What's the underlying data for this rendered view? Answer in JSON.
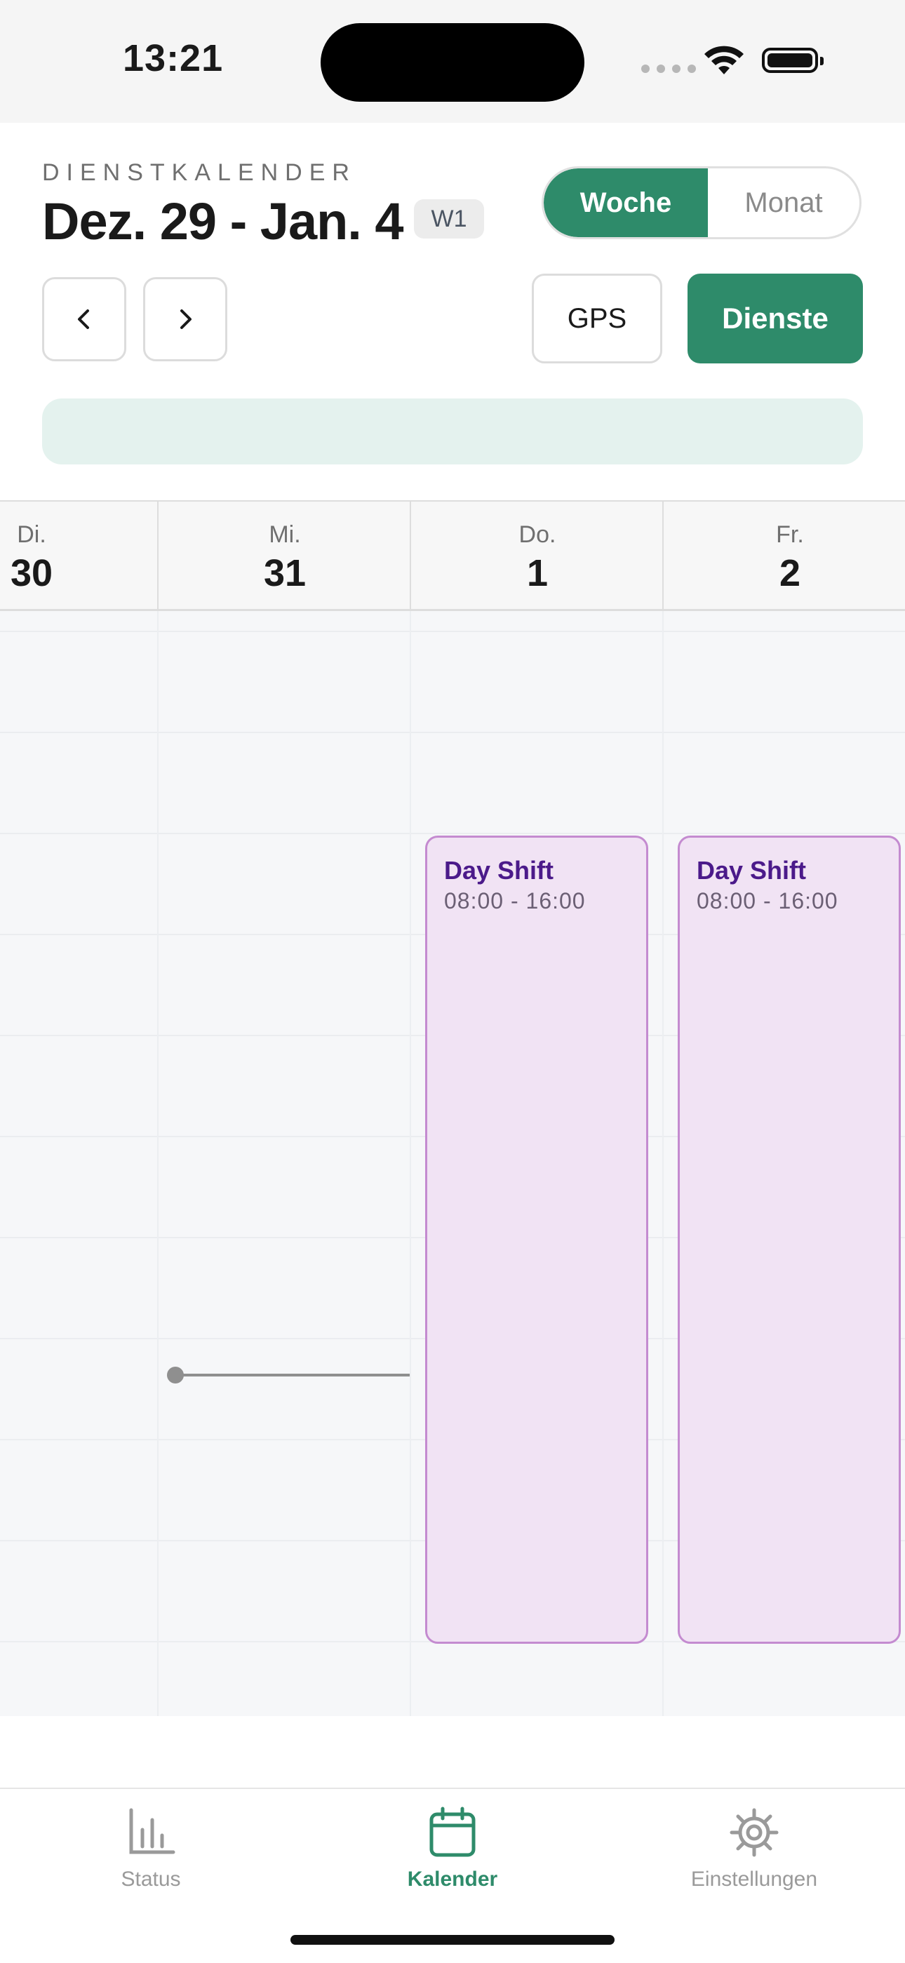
{
  "status_bar": {
    "time": "13:21"
  },
  "header": {
    "eyebrow": "DIENSTKALENDER",
    "date_range": "Dez. 29 - Jan. 4",
    "week_badge": "W1",
    "view_toggle": {
      "week": "Woche",
      "month": "Monat",
      "selected": "Woche"
    },
    "gps_label": "GPS",
    "shifts_label": "Dienste",
    "accent_color": "#2e8b6a"
  },
  "days": [
    {
      "name": "Di.",
      "date": "30"
    },
    {
      "name": "Mi.",
      "date": "31"
    },
    {
      "name": "Do.",
      "date": "1"
    },
    {
      "name": "Fr.",
      "date": "2"
    }
  ],
  "shifts": [
    {
      "day": "Do.",
      "title": "Day Shift",
      "hours": "08:00 - 16:00"
    },
    {
      "day": "Fr.",
      "title": "Day Shift",
      "hours": "08:00 - 16:00"
    }
  ],
  "tab_bar": {
    "items": [
      {
        "label": "Status",
        "icon": "bar-chart-icon"
      },
      {
        "label": "Kalender",
        "icon": "calendar-icon",
        "active": true
      },
      {
        "label": "Einstellungen",
        "icon": "gear-icon"
      }
    ]
  }
}
